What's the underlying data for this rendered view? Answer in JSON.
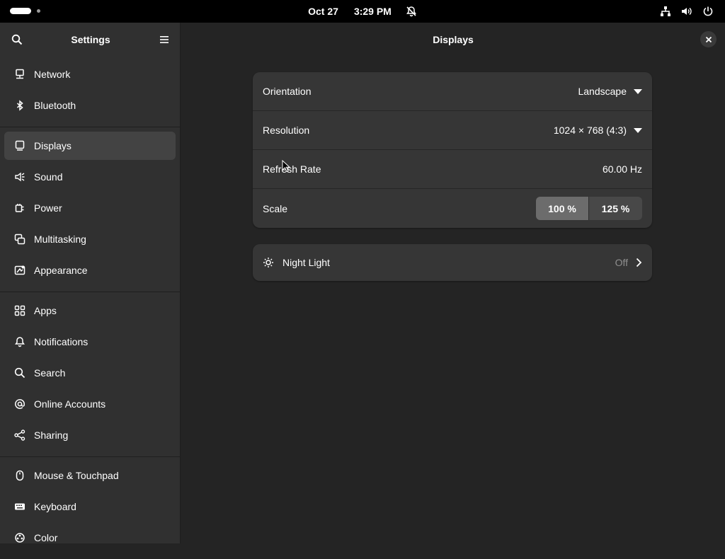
{
  "topbar": {
    "date": "Oct 27",
    "time": "3:29 PM"
  },
  "sidebar": {
    "title": "Settings",
    "groups": [
      [
        {
          "label": "Network",
          "icon": "network-icon"
        },
        {
          "label": "Bluetooth",
          "icon": "bluetooth-icon"
        }
      ],
      [
        {
          "label": "Displays",
          "icon": "display-icon",
          "active": true
        },
        {
          "label": "Sound",
          "icon": "sound-icon"
        },
        {
          "label": "Power",
          "icon": "power-plug-icon"
        },
        {
          "label": "Multitasking",
          "icon": "multitasking-icon"
        },
        {
          "label": "Appearance",
          "icon": "appearance-icon"
        }
      ],
      [
        {
          "label": "Apps",
          "icon": "apps-grid-icon"
        },
        {
          "label": "Notifications",
          "icon": "bell-icon"
        },
        {
          "label": "Search",
          "icon": "search-icon"
        },
        {
          "label": "Online Accounts",
          "icon": "at-icon"
        },
        {
          "label": "Sharing",
          "icon": "share-icon"
        }
      ],
      [
        {
          "label": "Mouse & Touchpad",
          "icon": "mouse-icon"
        },
        {
          "label": "Keyboard",
          "icon": "keyboard-icon"
        },
        {
          "label": "Color",
          "icon": "color-icon"
        }
      ]
    ]
  },
  "content": {
    "title": "Displays",
    "orientation": {
      "label": "Orientation",
      "value": "Landscape"
    },
    "resolution": {
      "label": "Resolution",
      "value": "1024 × 768 (4:3)"
    },
    "refresh": {
      "label": "Refresh Rate",
      "value": "60.00 Hz"
    },
    "scale": {
      "label": "Scale",
      "options": [
        "100 %",
        "125 %"
      ],
      "selected": "100 %"
    },
    "night_light": {
      "label": "Night Light",
      "value": "Off"
    }
  },
  "colors": {
    "background": "#242424",
    "sidebar": "#303030",
    "card": "#363636",
    "active_item": "#434343",
    "topbar": "#000000"
  }
}
